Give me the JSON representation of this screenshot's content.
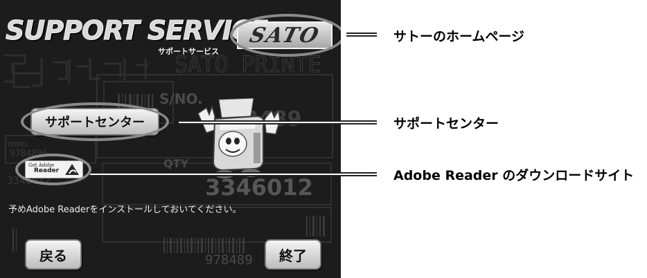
{
  "panel": {
    "title": "SUPPORT SERVICE",
    "subtitle": "サポートサービス",
    "logo_text": "SATO",
    "background_text": {
      "brand": "SATO PRINTE",
      "serial_label": "S/NO.",
      "serial_partial": "3489",
      "model_label": "MODEL",
      "qty_label": "QTY",
      "big_number": "3346012",
      "barcode_number_1": "9784896",
      "barcode_number_2": "978489",
      "small_number": "3346012"
    },
    "support_center_button": "サポートセンター",
    "adobe_badge": {
      "line1": "Get Adobe",
      "line2": "Reader"
    },
    "instruction": "予めAdobe Readerをインストールしておいてください。",
    "back_button": "戻る",
    "exit_button": "終了"
  },
  "callouts": {
    "logo": "サトーのホームページ",
    "support_center": "サポートセンター",
    "adobe": "Adobe Reader のダウンロードサイト"
  },
  "colors": {
    "panel_bg": "#1c1c1c",
    "button_light": "#f4f4f4",
    "button_dark": "#bdbdbd",
    "highlight_ellipse": "#8a8a8a",
    "adobe_red": "#c8102e"
  },
  "icons": {
    "mascot": "printer-mascot-icon",
    "adobe": "adobe-reader-icon"
  }
}
